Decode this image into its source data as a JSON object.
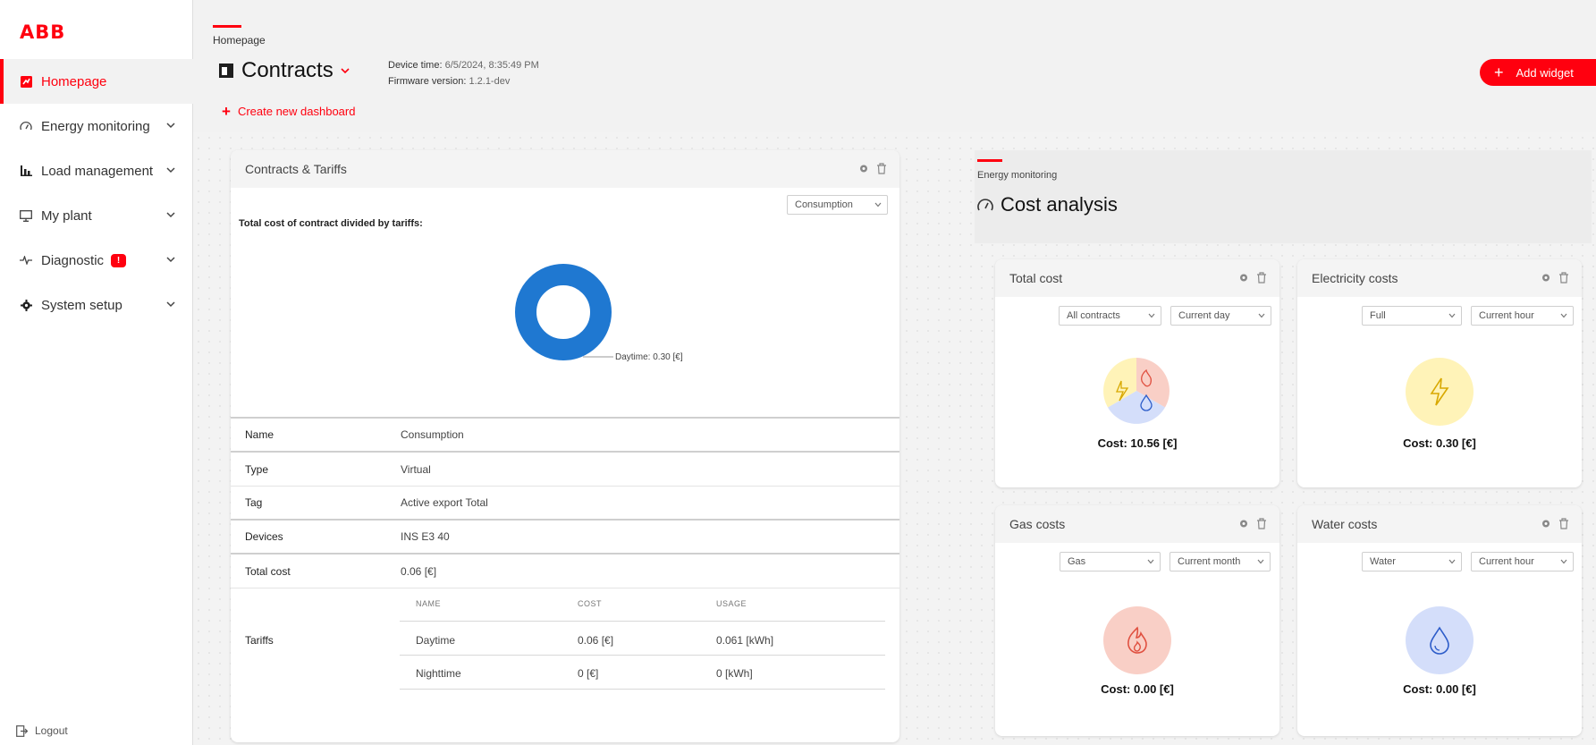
{
  "brand": {
    "logo": "ABB",
    "accent": "#ff000f"
  },
  "sidebar": {
    "items": [
      {
        "label": "Homepage",
        "icon": "dashboard-icon",
        "active": true
      },
      {
        "label": "Energy monitoring",
        "icon": "gauge-icon"
      },
      {
        "label": "Load management",
        "icon": "bar-chart-icon"
      },
      {
        "label": "My plant",
        "icon": "monitor-icon"
      },
      {
        "label": "Diagnostic",
        "icon": "pulse-icon",
        "badge": "!"
      },
      {
        "label": "System setup",
        "icon": "gear-icon"
      }
    ],
    "logout": "Logout"
  },
  "header": {
    "breadcrumb": "Homepage",
    "title": "Contracts",
    "device_time_label": "Device time:",
    "device_time": "6/5/2024, 8:35:49 PM",
    "firmware_label": "Firmware version:",
    "firmware": "1.2.1-dev",
    "create_dashboard": "Create new dashboard",
    "add_widget": "Add widget"
  },
  "contracts_card": {
    "title": "Contracts & Tariffs",
    "selector": "Consumption",
    "subtitle": "Total cost of contract divided by tariffs:",
    "donut_label": "Daytime: 0.30 [€]",
    "rows": [
      {
        "key": "Name",
        "value": "Consumption"
      },
      {
        "key": "Type",
        "value": "Virtual"
      },
      {
        "key": "Tag",
        "value": "Active export Total"
      },
      {
        "key": "Devices",
        "value": "INS E3 40"
      },
      {
        "key": "Total cost",
        "value": "0.06 [€]"
      }
    ],
    "tariffs_label": "Tariffs",
    "tariff_headers": [
      "NAME",
      "COST",
      "USAGE"
    ],
    "tariffs": [
      {
        "name": "Daytime",
        "cost": "0.06 [€]",
        "usage": "0.061 [kWh]"
      },
      {
        "name": "Nighttime",
        "cost": "0 [€]",
        "usage": "0 [kWh]"
      }
    ]
  },
  "energy_section": {
    "label": "Energy monitoring",
    "title": "Cost analysis"
  },
  "widgets": {
    "total": {
      "title": "Total cost",
      "select1": "All contracts",
      "select2": "Current day",
      "cost": "Cost: 10.56 [€]"
    },
    "electricity": {
      "title": "Electricity costs",
      "select1": "Full",
      "select2": "Current hour",
      "cost": "Cost: 0.30 [€]"
    },
    "gas": {
      "title": "Gas costs",
      "select1": "Gas",
      "select2": "Current month",
      "cost": "Cost: 0.00 [€]"
    },
    "water": {
      "title": "Water costs",
      "select1": "Water",
      "select2": "Current hour",
      "cost": "Cost: 0.00 [€]"
    }
  },
  "colors": {
    "electricity": "#fff3b8",
    "gas": "#f9cfc6",
    "water": "#d4defa",
    "donut": "#1f78d1"
  }
}
